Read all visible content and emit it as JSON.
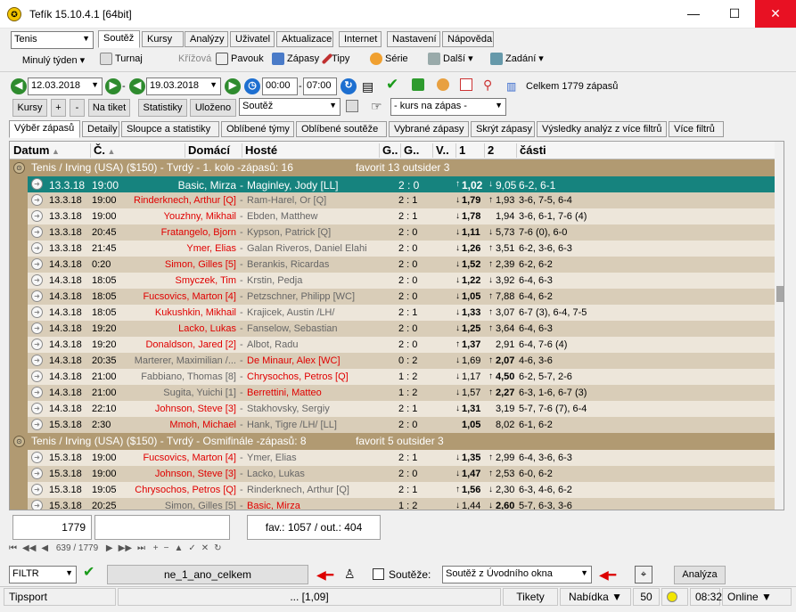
{
  "window": {
    "title": "Tefík 15.10.4.1 [64bit]",
    "minimize": "—",
    "maximize": "☐",
    "close": "✕"
  },
  "left": {
    "sport": "Tenis",
    "period": "Minulý týden"
  },
  "main_tabs": [
    "Soutěž",
    "Kursy",
    "Analýzy",
    "Uživatel",
    "Aktualizace",
    "Internet",
    "Nastavení",
    "Nápověda"
  ],
  "toolbar": {
    "turnaj": "Turnaj",
    "krizova": "Křížová",
    "pavouk": "Pavouk",
    "zapasy": "Zápasy",
    "tipy": "Tipy",
    "serie": "Série",
    "dalsi": "Další",
    "zadani": "Zadání"
  },
  "dates": {
    "from": "12.03.2018",
    "to": "19.03.2018",
    "time_from": "00:00",
    "time_to": "07:00",
    "total": "Celkem 1779 zápasů",
    "sep": "-"
  },
  "buttons": {
    "kursy": "Kursy",
    "plus": "+",
    "minus": "-",
    "na_tiket": "Na tiket",
    "statistiky": "Statistiky",
    "ulozeno": "Uloženo",
    "soutez": "Soutěž",
    "kurs": "- kurs na zápas -"
  },
  "sub_tabs": [
    "Výběr zápasů",
    "Detaily",
    "Sloupce a statistiky",
    "Oblíbené týmy",
    "Oblíbené soutěže",
    "Vybrané zápasy",
    "Skrýt zápasy",
    "Výsledky analýz z více filtrů",
    "Více filtrů"
  ],
  "columns": [
    "Datum",
    "Č.",
    "Domácí",
    "Hosté",
    "G..",
    "G..",
    "V..",
    "1",
    "2",
    "části"
  ],
  "groups": [
    {
      "title": "Tenis / Irving (USA)  ($150) - Tvrdý - 1. kolo -zápasů: 16",
      "fav": "favorit 13  outsider 3",
      "rows": [
        [
          "13.3.18",
          "19:00",
          "Basic, Mirza",
          "Maginley, Jody [LL]",
          "2 : 0",
          "↑",
          "1,02",
          "↓",
          "9,05",
          "6-2, 6-1",
          "sel"
        ],
        [
          "13.3.18",
          "19:00",
          "Rinderknech, Arthur [Q]",
          "Ram-Harel, Or [Q]",
          "2 : 1",
          "↓",
          "1,79",
          "↑",
          "1,93",
          "3-6, 7-5, 6-4",
          "h"
        ],
        [
          "13.3.18",
          "19:00",
          "Youzhny, Mikhail",
          "Ebden, Matthew",
          "2 : 1",
          "↓",
          "1,78",
          "",
          "1,94",
          "3-6, 6-1, 7-6 (4)",
          "h"
        ],
        [
          "13.3.18",
          "20:45",
          "Fratangelo, Bjorn",
          "Kypson, Patrick [Q]",
          "2 : 0",
          "↓",
          "1,11",
          "↓",
          "5,73",
          "7-6 (0), 6-0",
          "h"
        ],
        [
          "13.3.18",
          "21:45",
          "Ymer, Elias",
          "Galan Riveros, Daniel Elahi",
          "2 : 0",
          "↓",
          "1,26",
          "↑",
          "3,51",
          "6-2, 3-6, 6-3",
          "h"
        ],
        [
          "14.3.18",
          "0:20",
          "Simon, Gilles [5]",
          "Berankis, Ricardas",
          "2 : 0",
          "↓",
          "1,52",
          "↑",
          "2,39",
          "6-2, 6-2",
          "h"
        ],
        [
          "14.3.18",
          "18:05",
          "Smyczek, Tim",
          "Krstin, Pedja",
          "2 : 0",
          "↓",
          "1,22",
          "↓",
          "3,92",
          "6-4, 6-3",
          "h"
        ],
        [
          "14.3.18",
          "18:05",
          "Fucsovics, Marton [4]",
          "Petzschner, Philipp [WC]",
          "2 : 0",
          "↓",
          "1,05",
          "↑",
          "7,88",
          "6-4, 6-2",
          "h"
        ],
        [
          "14.3.18",
          "18:05",
          "Kukushkin, Mikhail",
          "Krajicek, Austin /LH/",
          "2 : 1",
          "↓",
          "1,33",
          "↑",
          "3,07",
          "6-7 (3), 6-4, 7-5",
          "h"
        ],
        [
          "14.3.18",
          "19:20",
          "Lacko, Lukas",
          "Fanselow, Sebastian",
          "2 : 0",
          "↓",
          "1,25",
          "↑",
          "3,64",
          "6-4, 6-3",
          "h"
        ],
        [
          "14.3.18",
          "19:20",
          "Donaldson, Jared [2]",
          "Albot, Radu",
          "2 : 0",
          "↑",
          "1,37",
          "",
          "2,91",
          "6-4, 7-6 (4)",
          "h"
        ],
        [
          "14.3.18",
          "20:35",
          "Marterer, Maximilian /...",
          "De Minaur, Alex [WC]",
          "0 : 2",
          "↓",
          "1,69",
          "↑",
          "2,07",
          "4-6, 3-6",
          "a"
        ],
        [
          "14.3.18",
          "21:00",
          "Fabbiano, Thomas [8]",
          "Chrysochos, Petros [Q]",
          "1 : 2",
          "↓",
          "1,17",
          "↑",
          "4,50",
          "6-2, 5-7, 2-6",
          "a"
        ],
        [
          "14.3.18",
          "21:00",
          "Sugita, Yuichi [1]",
          "Berrettini, Matteo",
          "1 : 2",
          "↓",
          "1,57",
          "↑",
          "2,27",
          "6-3, 1-6, 6-7 (3)",
          "a"
        ],
        [
          "14.3.18",
          "22:10",
          "Johnson, Steve [3]",
          "Stakhovsky, Sergiy",
          "2 : 1",
          "↓",
          "1,31",
          "",
          "3,19",
          "5-7, 7-6 (7), 6-4",
          "h"
        ],
        [
          "15.3.18",
          "2:30",
          "Mmoh, Michael",
          "Hank, Tigre /LH/ [LL]",
          "2 : 0",
          "",
          "1,05",
          "",
          "8,02",
          "6-1, 6-2",
          "h"
        ]
      ]
    },
    {
      "title": "Tenis / Irving (USA)  ($150) - Tvrdý - Osmifinále -zápasů: 8",
      "fav": "favorit 5  outsider 3",
      "rows": [
        [
          "15.3.18",
          "19:00",
          "Fucsovics, Marton [4]",
          "Ymer, Elias",
          "2 : 1",
          "↓",
          "1,35",
          "↑",
          "2,99",
          "6-4, 3-6, 6-3",
          "h"
        ],
        [
          "15.3.18",
          "19:00",
          "Johnson, Steve [3]",
          "Lacko, Lukas",
          "2 : 0",
          "↓",
          "1,47",
          "↑",
          "2,53",
          "6-0, 6-2",
          "h"
        ],
        [
          "15.3.18",
          "19:05",
          "Chrysochos, Petros [Q]",
          "Rinderknech, Arthur [Q]",
          "2 : 1",
          "↑",
          "1,56",
          "↓",
          "2,30",
          "6-3, 4-6, 6-2",
          "h"
        ],
        [
          "15.3.18",
          "20:25",
          "Simon, Gilles [5]",
          "Basic, Mirza",
          "1 : 2",
          "↓",
          "1,44",
          "↓",
          "2,60",
          "5-7, 6-3, 3-6",
          "a"
        ]
      ]
    }
  ],
  "summary": {
    "count": "1779",
    "fav": "fav.: 1057 / out.: 404"
  },
  "nav": {
    "pos": "639 / 1779"
  },
  "filter": {
    "label": "FILTR",
    "name": "ne_1_ano_celkem",
    "soutez_label": "Soutěže:",
    "soutez_value": "Soutěž z Úvodního okna",
    "analyza": "Analýza"
  },
  "status": {
    "bookmaker": "Tipsport",
    "middle": "... [1,09]",
    "tikety": "Tikety",
    "nabidka": "Nabídka ▼",
    "count": "50",
    "time": "08:32",
    "online": "Online ▼"
  }
}
